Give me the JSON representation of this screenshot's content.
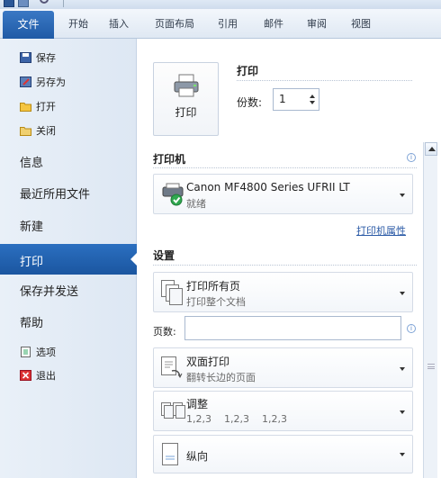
{
  "ribbon": {
    "file_tab": "文件",
    "tabs": [
      "开始",
      "插入",
      "页面布局",
      "引用",
      "邮件",
      "审阅",
      "视图"
    ]
  },
  "nav": {
    "save": "保存",
    "save_as": "另存为",
    "open": "打开",
    "close": "关闭",
    "info": "信息",
    "recent": "最近所用文件",
    "new": "新建",
    "print": "打印",
    "save_send": "保存并发送",
    "help": "帮助",
    "options": "选项",
    "exit": "退出"
  },
  "print": {
    "button_label": "打印",
    "heading": "打印",
    "copies_label": "份数:",
    "copies_value": "1"
  },
  "printer": {
    "section_title": "打印机",
    "name": "Canon MF4800 Series UFRII LT",
    "status": "就绪",
    "properties_link": "打印机属性"
  },
  "settings": {
    "section_title": "设置",
    "print_range": {
      "title": "打印所有页",
      "subtitle": "打印整个文档"
    },
    "pages_label": "页数:",
    "duplex": {
      "title": "双面打印",
      "subtitle": "翻转长边的页面"
    },
    "collate": {
      "title": "调整",
      "subtitle": "1,2,3    1,2,3    1,2,3"
    },
    "orientation": {
      "title": "纵向"
    }
  },
  "colors": {
    "accent": "#1f5aa6",
    "nav_bg": "#e4ecf6"
  }
}
